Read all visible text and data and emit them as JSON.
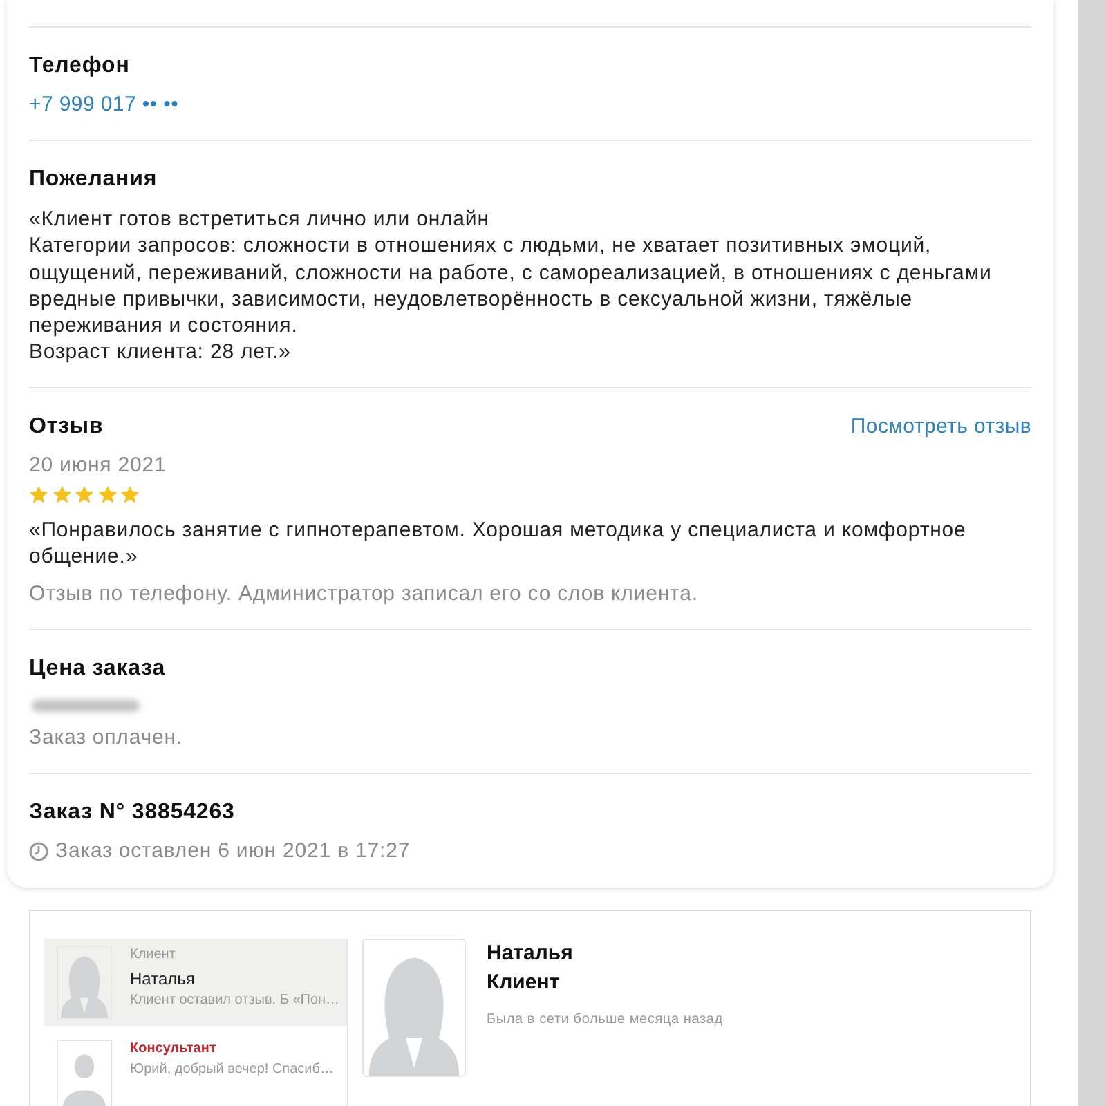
{
  "contact": {
    "label": "Телефон",
    "phone": "+7 999 017 •• ••"
  },
  "wishes": {
    "label": "Пожелания",
    "text": "«Клиент готов встретиться лично или онлайн\nКатегории запросов: сложности в отношениях с людьми, не хватает позитивных эмоций, ощущений, переживаний, сложности на работе, с самореализацией, в отношениях с деньгами вредные привычки, зависимости, неудовлетворённость в сексуальной жизни, тяжёлые переживания и состояния.\nВозраст клиента: 28 лет.»"
  },
  "review": {
    "label": "Отзыв",
    "link": "Посмотреть отзыв",
    "date": "20 июня 2021",
    "stars": 5,
    "quote": "«Понравилось занятие с гипнотерапевтом. Хорошая методика у специалиста и комфортное общение.»",
    "note": "Отзыв по телефону. Администратор записал его со слов клиента."
  },
  "price": {
    "label": "Цена заказа",
    "status": "Заказ оплачен."
  },
  "order": {
    "title": "Заказ N° 38854263",
    "created": "Заказ оставлен 6 июн 2021 в 17:27"
  },
  "chat": {
    "conversations": [
      {
        "kind": "client",
        "role": "Клиент",
        "name": "Наталья",
        "preview": "Клиент оставил отзыв. Б «Пон…",
        "selected": true
      },
      {
        "kind": "consultant",
        "role": "Консультант",
        "preview": "Юрий, добрый вечер! Спасиб…",
        "selected": false
      }
    ],
    "profile": {
      "kind": "client",
      "name": "Наталья",
      "role": "Клиент",
      "last_seen": "Была в сети больше месяца назад"
    }
  }
}
